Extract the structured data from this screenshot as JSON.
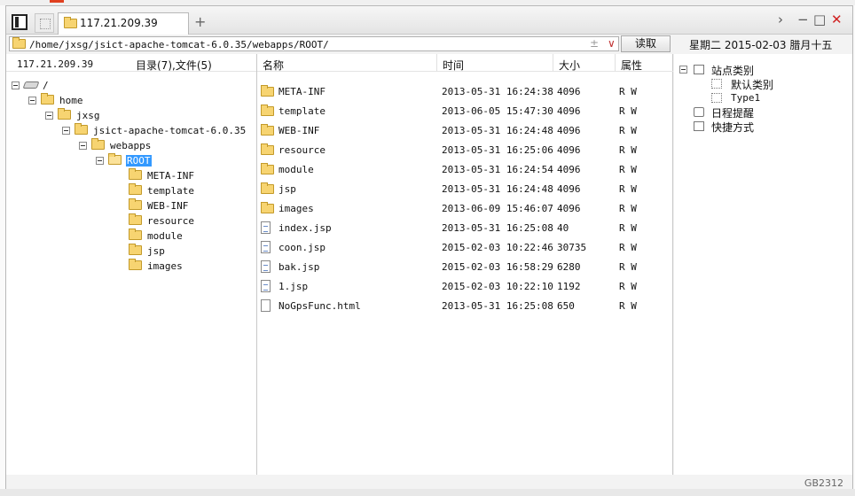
{
  "window": {
    "tab_title": "117.21.209.39",
    "new_tab": "+",
    "controls": {
      "chevron": "›",
      "minimize": "−",
      "maximize": "□",
      "close": "✕"
    }
  },
  "address": {
    "path": "/home/jxsg/jsict-apache-tomcat-6.0.35/webapps/ROOT/",
    "plus_minus": "±",
    "dropdown": "∨",
    "read_button": "读取"
  },
  "date_line": "星期二 2015-02-03 腊月十五",
  "left_pane": {
    "host": "117.21.209.39",
    "summary": "目录(7),文件(5)",
    "tree": [
      {
        "label": "/",
        "depth": 0,
        "icon": "drive-icon"
      },
      {
        "label": "home",
        "depth": 1
      },
      {
        "label": "jxsg",
        "depth": 2
      },
      {
        "label": "jsict-apache-tomcat-6.0.35",
        "depth": 3
      },
      {
        "label": "webapps",
        "depth": 4
      },
      {
        "label": "ROOT",
        "depth": 5,
        "selected": true
      }
    ],
    "leaves": [
      "META-INF",
      "template",
      "WEB-INF",
      "resource",
      "module",
      "jsp",
      "images"
    ]
  },
  "file_list": {
    "headers": {
      "name": "名称",
      "time": "时间",
      "size": "大小",
      "attr": "属性"
    },
    "rows": [
      {
        "type": "folder",
        "name": "META-INF",
        "time": "2013-05-31 16:24:38",
        "size": "4096",
        "attr": "R W"
      },
      {
        "type": "folder",
        "name": "template",
        "time": "2013-06-05 15:47:30",
        "size": "4096",
        "attr": "R W"
      },
      {
        "type": "folder",
        "name": "WEB-INF",
        "time": "2013-05-31 16:24:48",
        "size": "4096",
        "attr": "R W"
      },
      {
        "type": "folder",
        "name": "resource",
        "time": "2013-05-31 16:25:06",
        "size": "4096",
        "attr": "R W"
      },
      {
        "type": "folder",
        "name": "module",
        "time": "2013-05-31 16:24:54",
        "size": "4096",
        "attr": "R W"
      },
      {
        "type": "folder",
        "name": "jsp",
        "time": "2013-05-31 16:24:48",
        "size": "4096",
        "attr": "R W"
      },
      {
        "type": "folder",
        "name": "images",
        "time": "2013-06-09 15:46:07",
        "size": "4096",
        "attr": "R W"
      },
      {
        "type": "file",
        "name": "index.jsp",
        "time": "2013-05-31 16:25:08",
        "size": "40",
        "attr": "R W"
      },
      {
        "type": "file",
        "name": "coon.jsp",
        "time": "2015-02-03 10:22:46",
        "size": "30735",
        "attr": "R W"
      },
      {
        "type": "file",
        "name": "bak.jsp",
        "time": "2015-02-03 16:58:29",
        "size": "6280",
        "attr": "R W"
      },
      {
        "type": "file",
        "name": "1.jsp",
        "time": "2015-02-03 10:22:10",
        "size": "1192",
        "attr": "R W"
      },
      {
        "type": "file-plain",
        "name": "NoGpsFunc.html",
        "time": "2013-05-31 16:25:08",
        "size": "650",
        "attr": "R W"
      }
    ]
  },
  "right_pane": {
    "site_category": "站点类别",
    "default_category": "默认类别",
    "type1": "Type1",
    "schedule": "日程提醒",
    "shortcuts": "快捷方式"
  },
  "watermark": "GB2312"
}
